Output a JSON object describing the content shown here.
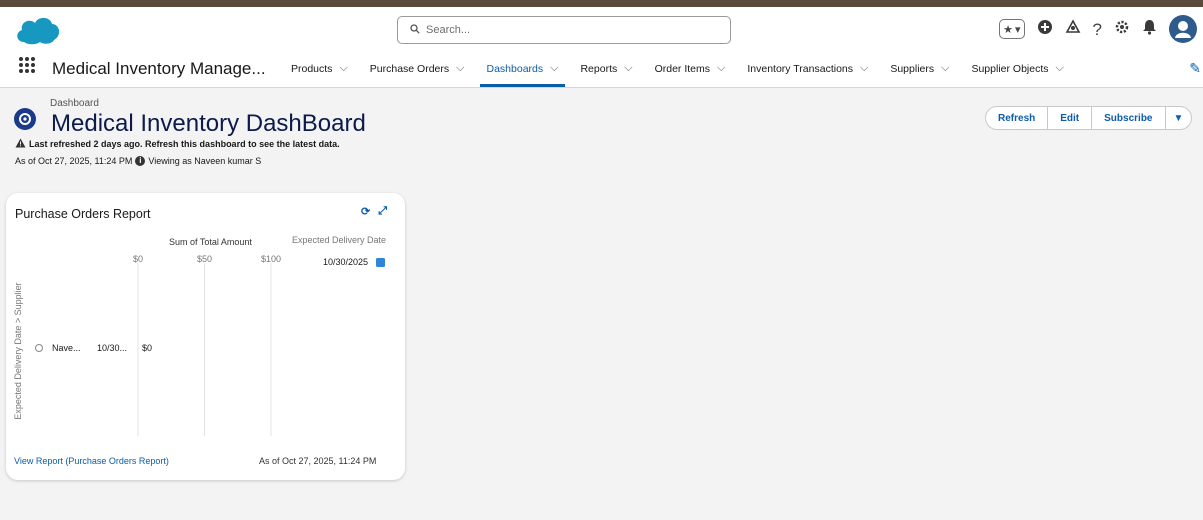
{
  "header": {
    "search_placeholder": "Search...",
    "icons": [
      "favorites-star-icon",
      "add-icon",
      "trailhead-icon",
      "help-icon",
      "setup-gear-icon",
      "notifications-bell-icon",
      "avatar"
    ]
  },
  "nav": {
    "app_name": "Medical Inventory Manage...",
    "items": [
      {
        "label": "Products",
        "active": false
      },
      {
        "label": "Purchase Orders",
        "active": false
      },
      {
        "label": "Dashboards",
        "active": true
      },
      {
        "label": "Reports",
        "active": false
      },
      {
        "label": "Order Items",
        "active": false
      },
      {
        "label": "Inventory Transactions",
        "active": false
      },
      {
        "label": "Suppliers",
        "active": false
      },
      {
        "label": "Supplier Objects",
        "active": false
      }
    ]
  },
  "dashboard": {
    "eyebrow": "Dashboard",
    "title": "Medical Inventory DashBoard",
    "refresh_note": "Last refreshed 2 days ago. Refresh this dashboard to see the latest data.",
    "as_of": "As of Oct 27, 2025, 11:24 PM",
    "viewing_as": "Viewing as Naveen kumar S",
    "buttons": {
      "refresh": "Refresh",
      "edit": "Edit",
      "subscribe": "Subscribe"
    }
  },
  "card": {
    "title": "Purchase Orders Report",
    "link": "View Report (Purchase Orders Report)",
    "as_of": "As of Oct 27, 2025, 11:24 PM"
  },
  "chart_data": {
    "type": "bar",
    "orientation": "horizontal",
    "title": "",
    "xlabel": "Sum of Total Amount",
    "ylabel": "Expected Delivery Date > Supplier",
    "x_ticks": [
      "$0",
      "$50",
      "$100"
    ],
    "xlim": [
      0,
      100
    ],
    "legend_title": "Expected Delivery Date",
    "legend": [
      {
        "name": "10/30/2025",
        "color": "#2f86d8"
      }
    ],
    "rows": [
      {
        "group": "10/30...",
        "supplier": "Nave...",
        "value": 0,
        "value_label": "$0"
      }
    ],
    "grid": true
  }
}
